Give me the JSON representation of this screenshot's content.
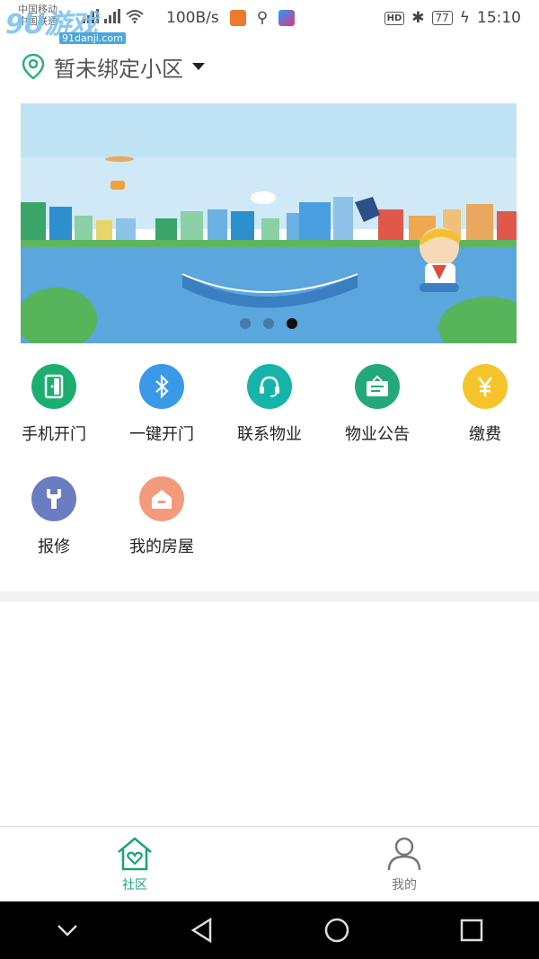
{
  "status_bar": {
    "carrier1": "中国移动",
    "carrier2": "中国联通",
    "speed": "100B/s",
    "battery": "77",
    "time": "15:10",
    "hd_label": "HD"
  },
  "watermark": {
    "logo": "9U游戏",
    "url": "91danji.com"
  },
  "header": {
    "location_text": "暂未绑定小区"
  },
  "banner": {
    "slide_count": 3,
    "active_index": 2
  },
  "grid": {
    "row1": [
      {
        "label": "手机开门",
        "color": "#1aae6f",
        "icon": "door-icon"
      },
      {
        "label": "一键开门",
        "color": "#3a99e8",
        "icon": "bluetooth-icon"
      },
      {
        "label": "联系物业",
        "color": "#16b3a8",
        "icon": "headset-icon"
      },
      {
        "label": "物业公告",
        "color": "#23a87a",
        "icon": "notice-board-icon"
      },
      {
        "label": "缴费",
        "color": "#f5c42a",
        "icon": "yuan-icon"
      }
    ],
    "row2": [
      {
        "label": "报修",
        "color": "#6b7dc1",
        "icon": "wrench-icon"
      },
      {
        "label": "我的房屋",
        "color": "#f39a7d",
        "icon": "house-icon"
      }
    ]
  },
  "tabbar": {
    "community_label": "社区",
    "mine_label": "我的",
    "active_color": "#1aa37a"
  }
}
